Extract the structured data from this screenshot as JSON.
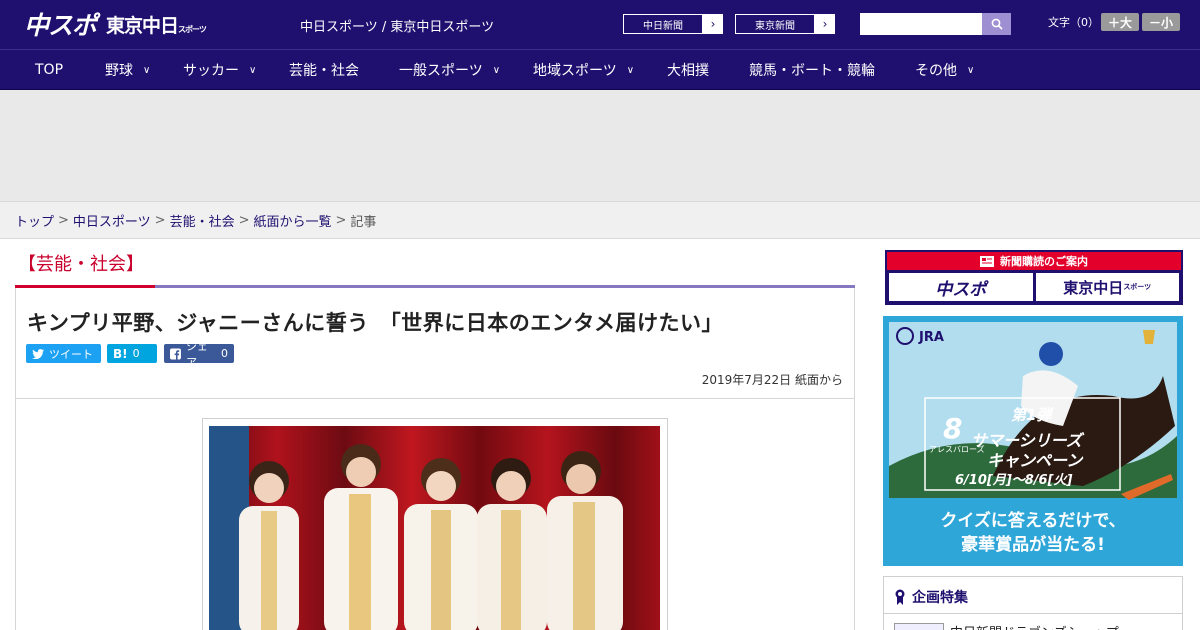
{
  "header": {
    "logo_main": "中スポ",
    "logo_sub": "東京中日",
    "logo_sub_small": "スポーツ",
    "site_names": "中日スポーツ / 東京中日スポーツ",
    "ext_links": [
      "中日新聞",
      "東京新聞"
    ],
    "search_placeholder": "",
    "font_label": "文字（0）",
    "font_larger": "＋大",
    "font_smaller": "－小"
  },
  "nav": {
    "items": [
      {
        "label": "TOP",
        "has_menu": false
      },
      {
        "label": "野球",
        "has_menu": true
      },
      {
        "label": "サッカー",
        "has_menu": true
      },
      {
        "label": "芸能・社会",
        "has_menu": false
      },
      {
        "label": "一般スポーツ",
        "has_menu": true
      },
      {
        "label": "地域スポーツ",
        "has_menu": true
      },
      {
        "label": "大相撲",
        "has_menu": false
      },
      {
        "label": "競馬・ボート・競輪",
        "has_menu": false
      },
      {
        "label": "その他",
        "has_menu": true
      }
    ]
  },
  "breadcrumb": {
    "items": [
      "トップ",
      "中日スポーツ",
      "芸能・社会",
      "紙面から一覧"
    ],
    "current": "記事",
    "separator": ">"
  },
  "article": {
    "category": "【芸能・社会】",
    "headline": "キンプリ平野、ジャニーさんに誓う　「世界に日本のエンタメ届けたい」",
    "share": {
      "tweet": "ツイート",
      "hatena_label": "B!",
      "hatena_count": "0",
      "facebook_label": "シェア",
      "facebook_count": "0"
    },
    "dateline": "2019年7月22日 紙面から"
  },
  "sidebar": {
    "subscribe_strip": "新聞購読のご案内",
    "subscribe_logos": [
      "中スポ",
      "東京中日"
    ],
    "subscribe_logo_small": "スポーツ",
    "jra_ad": {
      "brand": "JRA",
      "number": "8",
      "horse": "アレスバローズ",
      "round": "第1弾",
      "campaign_line1": "サマーシリーズ",
      "campaign_line2": "キャンペーン",
      "period": "6/10[月]～8/6[火]",
      "cta_line1": "クイズに答えるだけで、",
      "cta_line2": "豪華賞品が当たる!"
    },
    "feature_title": "企画特集",
    "feature_item": "中日新聞ドラゴンズショップ"
  },
  "colors": {
    "brand_navy": "#1f1070",
    "accent_red": "#c9002c",
    "accent_purple": "#8577c0"
  }
}
